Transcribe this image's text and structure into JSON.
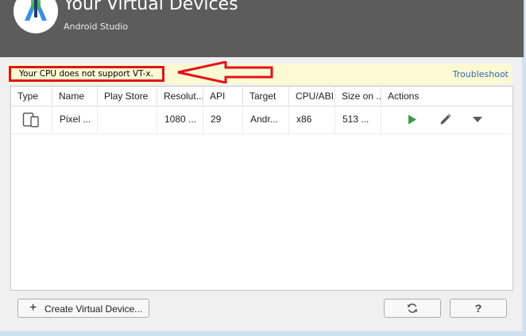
{
  "header": {
    "title": "Your Virtual Devices",
    "subtitle": "Android Studio",
    "logo_icon": "android-studio-logo-icon",
    "background_color": "#5c5c5c"
  },
  "warning": {
    "message": "Your CPU does not support VT-x.",
    "link_label": "Troubleshoot",
    "highlight_color": "#e0131b",
    "background_color": "#fdf9d3"
  },
  "table": {
    "columns": [
      "Type",
      "Name",
      "Play Store",
      "Resolut...",
      "API",
      "Target",
      "CPU/ABI",
      "Size on ...",
      "Actions"
    ],
    "rows": [
      {
        "type_icon": "phone-tablet-icon",
        "name": "Pixel ...",
        "play_store": "",
        "resolution": "1080 ...",
        "api": "29",
        "target": "Andr...",
        "cpu_abi": "x86",
        "size": "513 ...",
        "actions": [
          "play-icon",
          "pencil-icon",
          "dropdown-arrow-icon"
        ]
      }
    ]
  },
  "footer": {
    "create_label": "Create Virtual Device...",
    "create_icon": "plus-icon",
    "refresh_icon": "refresh-icon",
    "help_label": "?"
  },
  "colors": {
    "play": "#3e9a4a",
    "link": "#2c6ab8"
  }
}
